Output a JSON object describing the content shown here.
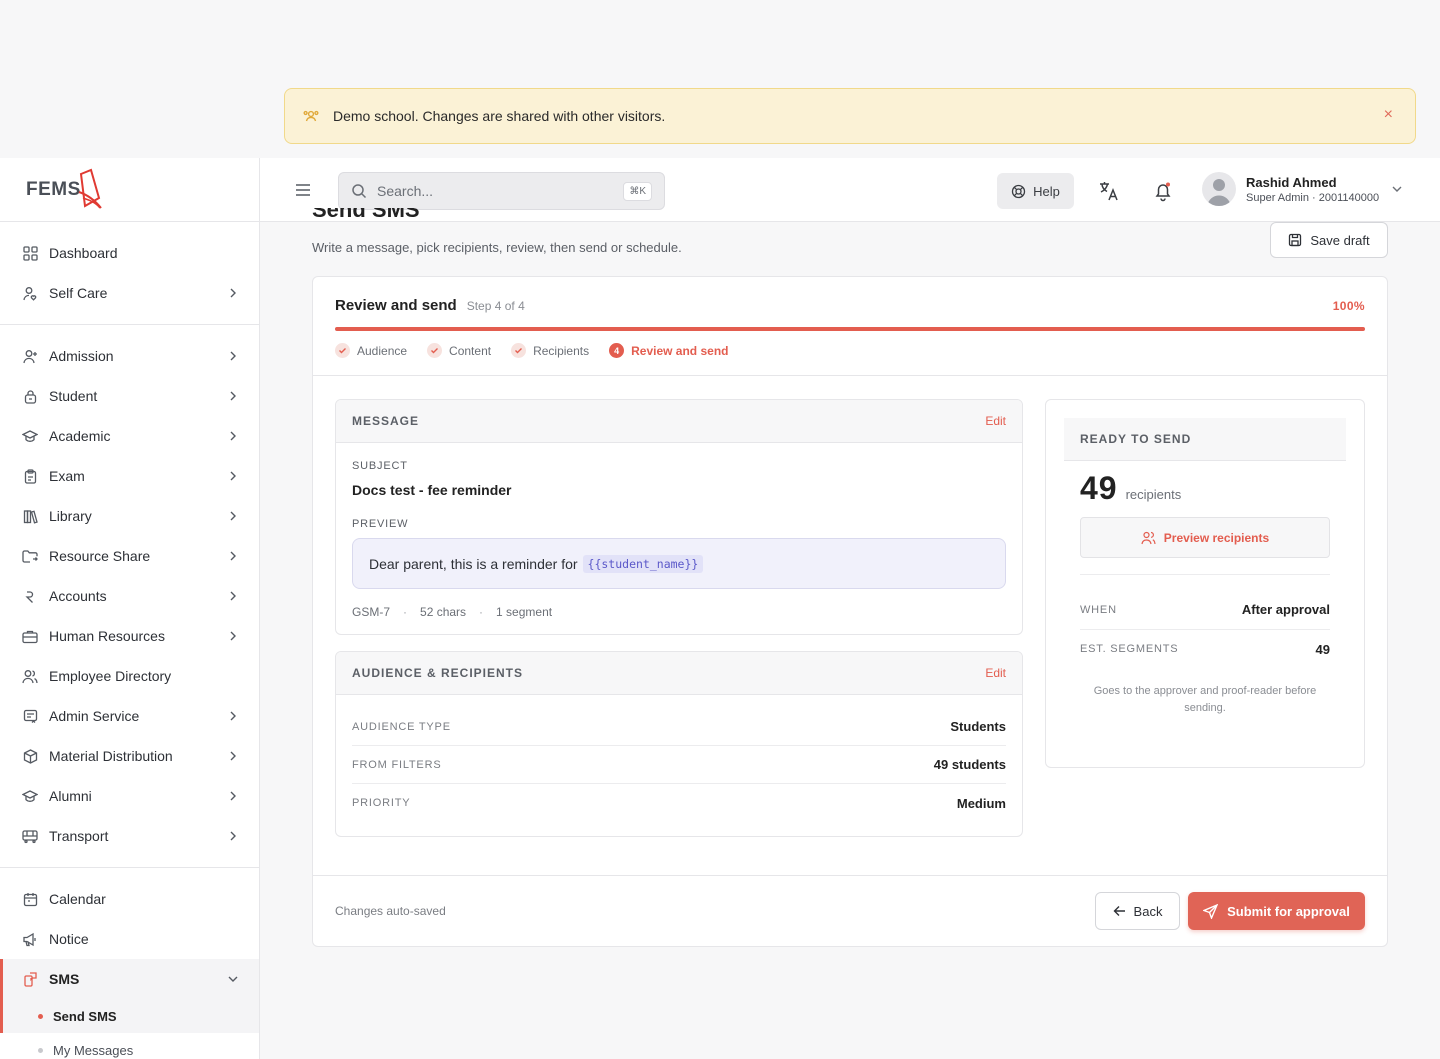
{
  "banner": {
    "text": "Demo school. Changes are shared with other visitors.",
    "close": "×"
  },
  "logo": {
    "text": "FEMS"
  },
  "sidebar": {
    "group1": [
      {
        "label": "Dashboard",
        "icon": "grid-icon",
        "chevron": false
      },
      {
        "label": "Self Care",
        "icon": "user-heart-icon",
        "chevron": true
      }
    ],
    "group2": [
      {
        "label": "Admission",
        "icon": "user-plus-icon",
        "chevron": true
      },
      {
        "label": "Student",
        "icon": "student-icon",
        "chevron": true
      },
      {
        "label": "Academic",
        "icon": "graduation-cap-icon",
        "chevron": true
      },
      {
        "label": "Exam",
        "icon": "clipboard-icon",
        "chevron": true
      },
      {
        "label": "Library",
        "icon": "books-icon",
        "chevron": true
      },
      {
        "label": "Resource Share",
        "icon": "folder-share-icon",
        "chevron": true
      },
      {
        "label": "Accounts",
        "icon": "rupee-icon",
        "chevron": true
      },
      {
        "label": "Human Resources",
        "icon": "briefcase-icon",
        "chevron": true
      },
      {
        "label": "Employee Directory",
        "icon": "users-icon",
        "chevron": false
      },
      {
        "label": "Admin Service",
        "icon": "admin-service-icon",
        "chevron": true
      },
      {
        "label": "Material Distribution",
        "icon": "box-icon",
        "chevron": true
      },
      {
        "label": "Alumni",
        "icon": "graduation-cap-icon",
        "chevron": true
      },
      {
        "label": "Transport",
        "icon": "bus-icon",
        "chevron": true
      }
    ],
    "group3": [
      {
        "label": "Calendar",
        "icon": "calendar-icon"
      },
      {
        "label": "Notice",
        "icon": "megaphone-icon"
      },
      {
        "label": "SMS",
        "icon": "sms-icon"
      }
    ],
    "sms_sub": [
      {
        "label": "Send SMS"
      },
      {
        "label": "My Messages"
      }
    ]
  },
  "topbar": {
    "search_placeholder": "Search...",
    "search_shortcut": "⌘K",
    "help_label": "Help",
    "user_name": "Rashid Ahmed",
    "user_role": "Super Admin · 2001140000"
  },
  "page": {
    "title": "Send SMS",
    "subtitle": "Write a message, pick recipients, review, then send or schedule.",
    "save_draft": "Save draft"
  },
  "wizard": {
    "title": "Review and send",
    "step_text": "Step 4 of 4",
    "progress_label": "100%",
    "progress": 100,
    "steps": [
      {
        "label": "Audience",
        "done": true
      },
      {
        "label": "Content",
        "done": true
      },
      {
        "label": "Recipients",
        "done": true
      },
      {
        "label": "Review and send",
        "number": "4"
      }
    ]
  },
  "message": {
    "heading": "MESSAGE",
    "edit": "Edit",
    "subject_label": "SUBJECT",
    "subject": "Docs test - fee reminder",
    "preview_label": "PREVIEW",
    "preview_text": "Dear parent, this is a reminder for",
    "preview_token": "{{student_name}}",
    "encoding": "GSM-7",
    "chars": "52 chars",
    "segments": "1 segment",
    "sep": "·"
  },
  "audience": {
    "heading": "AUDIENCE & RECIPIENTS",
    "edit": "Edit",
    "rows": [
      {
        "k": "AUDIENCE TYPE",
        "v": "Students"
      },
      {
        "k": "FROM FILTERS",
        "v": "49 students"
      },
      {
        "k": "PRIORITY",
        "v": "Medium"
      }
    ]
  },
  "ready": {
    "heading": "READY TO SEND",
    "count": "49",
    "unit": "recipients",
    "preview_btn": "Preview recipients",
    "when_label": "WHEN",
    "when_value": "After approval",
    "seg_label": "EST. SEGMENTS",
    "seg_value": "49",
    "note": "Goes to the approver and proof-reader before sending."
  },
  "footer": {
    "autosaved": "Changes auto-saved",
    "back": "Back",
    "submit": "Submit for approval"
  },
  "colors": {
    "accent": "#e35d4f",
    "banner_bg": "#fbf2d6",
    "token_bg": "#e2e2f8"
  }
}
